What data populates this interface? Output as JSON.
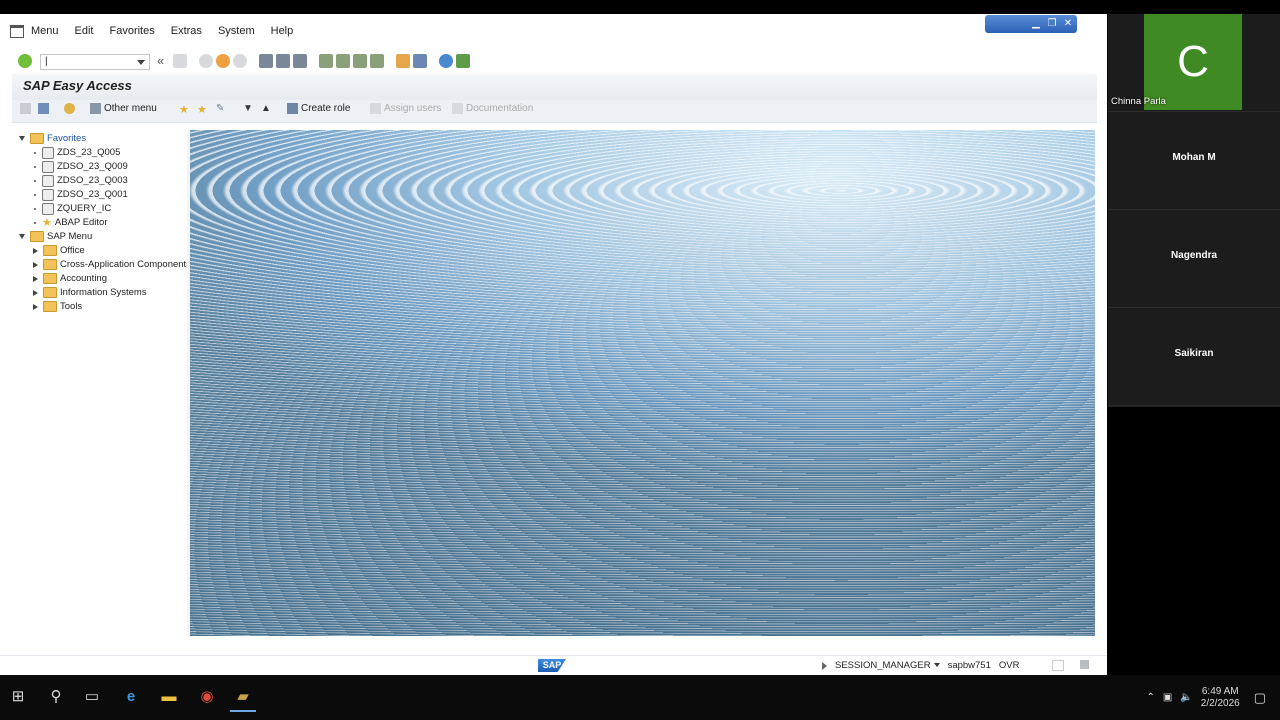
{
  "menubar": {
    "items": [
      "Menu",
      "Edit",
      "Favorites",
      "Extras",
      "System",
      "Help"
    ]
  },
  "toolbar": {
    "command_value": "|",
    "back_label": "«"
  },
  "page_title": "SAP Easy Access",
  "app_toolbar": {
    "other_menu": "Other menu",
    "create_role": "Create role",
    "assign_users": "Assign users",
    "documentation": "Documentation"
  },
  "tree": {
    "favorites": {
      "label": "Favorites",
      "items": [
        "ZDS_23_Q005",
        "ZDSO_23_Q009",
        "ZDSO_23_Q003",
        "ZDSO_23_Q001",
        "ZQUERY_IC",
        "ABAP Editor"
      ]
    },
    "sap_menu": {
      "label": "SAP Menu",
      "items": [
        "Office",
        "Cross-Application Components",
        "Accounting",
        "Information Systems",
        "Tools"
      ]
    }
  },
  "statusbar": {
    "logo": "SAP",
    "session": "SESSION_MANAGER",
    "system": "sapbw751",
    "mode": "OVR"
  },
  "participants": {
    "active_initial": "C",
    "active_name": "Chinna Parla",
    "others": [
      "Mohan M",
      "Nagendra",
      "Saikiran"
    ]
  },
  "taskbar": {
    "time": "6:49 AM",
    "date": "2/2/2026"
  },
  "colors": {
    "avatar_bg": "#3f8a22",
    "window_ctrl": "#2b5fb5",
    "folder": "#f3c35a"
  }
}
